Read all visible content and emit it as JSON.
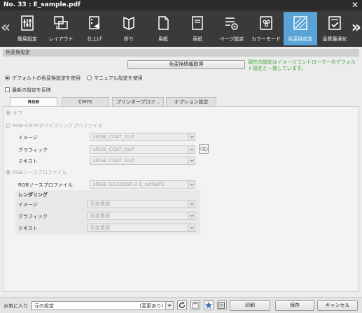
{
  "window": {
    "title": "No. 33 :  E_sample.pdf",
    "close": "✕"
  },
  "toolbar": {
    "tabs": [
      {
        "label": "簡易設定",
        "icon": "simple-settings-icon"
      },
      {
        "label": "レイアウト",
        "icon": "layout-icon"
      },
      {
        "label": "仕上げ",
        "icon": "finishing-icon"
      },
      {
        "label": "折り",
        "icon": "fold-icon"
      },
      {
        "label": "用紙",
        "icon": "paper-icon"
      },
      {
        "label": "表紙",
        "icon": "cover-icon"
      },
      {
        "label": "ページ設定",
        "icon": "page-settings-icon"
      },
      {
        "label": "カラーモード",
        "icon": "color-mode-icon"
      },
      {
        "label": "色変換設定",
        "icon": "color-conversion-icon",
        "active": true
      },
      {
        "label": "品質最適化",
        "icon": "quality-optimize-icon"
      }
    ],
    "accent": "#5aa3d6"
  },
  "section": {
    "title": "色変換設定",
    "get_info_button": "色変換情報取得",
    "status_message": "現在の設定はイメージコントローラーのデフォルト設定と一致しています。",
    "status_color": "#3aa832",
    "use_default": "デフォルトの色変換設定を使用",
    "use_manual": "マニュアル設定を使用",
    "reflect_latest": "最新の設定を反映"
  },
  "inner_tabs": [
    "RGB",
    "CMYK",
    "プリンタープロフ...",
    "オプション設定"
  ],
  "rgb": {
    "off": "オフ",
    "devicelink": "RGB-CMYKデバイスリンクプロファイル",
    "devicelink_rows": [
      {
        "label": "イメージ",
        "value": "sRGB_COAT_DLP"
      },
      {
        "label": "グラフィック",
        "value": "sRGB_COAT_DLP"
      },
      {
        "label": "テキスト",
        "value": "sRGB_COAT_DLP"
      }
    ],
    "source_profile": "RGBソースプロファイル",
    "source_profile_row": {
      "label": "RGBソースプロファイル",
      "value": "sRGB_IEC61966-2-1_withBPC"
    },
    "rendering_title": "レンダリング",
    "rendering_rows": [
      {
        "label": "イメージ",
        "value": "彩度重視"
      },
      {
        "label": "グラフィック",
        "value": "彩度重視"
      },
      {
        "label": "テキスト",
        "value": "彩度重視"
      }
    ]
  },
  "bottom": {
    "favorites_label": "お気に入り",
    "favorites_value": "元の設定",
    "favorites_suffix": "(変更あり)",
    "print_button": "印刷",
    "save_button": "保存",
    "cancel_button": "キャンセル"
  }
}
